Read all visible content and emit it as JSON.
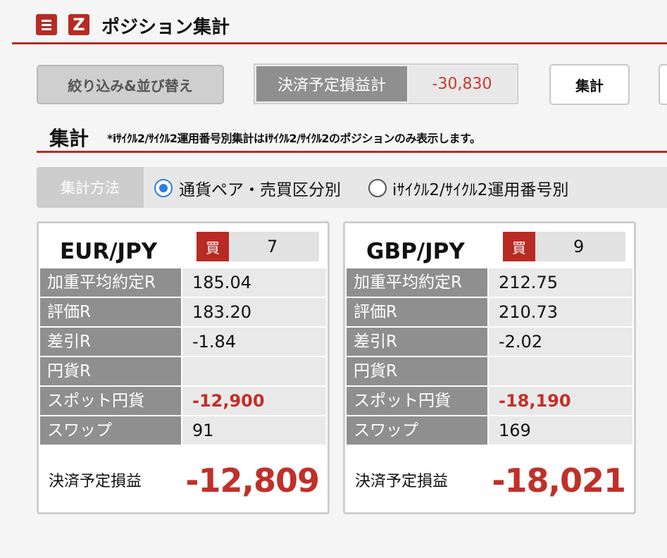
{
  "header": {
    "title": "ポジション集計",
    "menu_icon": "hamburger-menu-icon",
    "logo_icon": "z-logo-icon",
    "accent_color": "#b82a24"
  },
  "toolbar": {
    "filter_button": "絞り込み&並び替え",
    "settlement_total_label": "決済予定損益計",
    "settlement_total_value": "-30,830",
    "sum_button": "集計"
  },
  "section": {
    "title": "集計",
    "note": "*iｻｲｸﾙ2/ｻｲｸﾙ2運用番号別集計はiｻｲｸﾙ2/ｻｲｸﾙ2のポジションのみ表示します。"
  },
  "method": {
    "label": "集計方法",
    "options": [
      {
        "label": "通貨ペア・売買区分別",
        "selected": true
      },
      {
        "label": "iｻｲｸﾙ2/ｻｲｸﾙ2運用番号別",
        "selected": false
      }
    ]
  },
  "cards": [
    {
      "pair": "EUR/JPY",
      "side": "買",
      "count": "7",
      "rows": [
        {
          "label": "加重平均約定R",
          "value": "185.04"
        },
        {
          "label": "評価R",
          "value": "183.20"
        },
        {
          "label": "差引R",
          "value": "-1.84"
        },
        {
          "label": "円貨R",
          "value": ""
        },
        {
          "label": "スポット円貨",
          "value": "-12,900"
        },
        {
          "label": "スワップ",
          "value": "91"
        }
      ],
      "pl_label": "決済予定損益",
      "pl_value": "-12,809"
    },
    {
      "pair": "GBP/JPY",
      "side": "買",
      "count": "9",
      "rows": [
        {
          "label": "加重平均約定R",
          "value": "212.75"
        },
        {
          "label": "評価R",
          "value": "210.73"
        },
        {
          "label": "差引R",
          "value": "-2.02"
        },
        {
          "label": "円貨R",
          "value": ""
        },
        {
          "label": "スポット円貨",
          "value": "-18,190"
        },
        {
          "label": "スワップ",
          "value": "169"
        }
      ],
      "pl_label": "決済予定損益",
      "pl_value": "-18,021"
    }
  ]
}
